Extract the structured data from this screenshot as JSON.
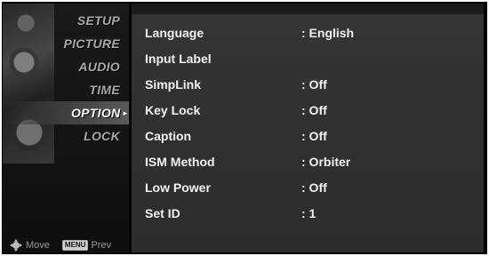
{
  "sidebar": {
    "items": [
      {
        "label": "SETUP",
        "active": false
      },
      {
        "label": "PICTURE",
        "active": false
      },
      {
        "label": "AUDIO",
        "active": false
      },
      {
        "label": "TIME",
        "active": false
      },
      {
        "label": "OPTION",
        "active": true
      },
      {
        "label": "LOCK",
        "active": false
      }
    ],
    "active_arrow": "▸",
    "footer": {
      "move_label": "Move",
      "menu_button": "MENU",
      "prev_label": "Prev"
    }
  },
  "main": {
    "rows": [
      {
        "label": "Language",
        "value": ": English"
      },
      {
        "label": "Input Label",
        "value": ""
      },
      {
        "label": "SimpLink",
        "value": ": Off"
      },
      {
        "label": "Key Lock",
        "value": ": Off"
      },
      {
        "label": "Caption",
        "value": ": Off"
      },
      {
        "label": "ISM Method",
        "value": ": Orbiter"
      },
      {
        "label": "Low Power",
        "value": ": Off"
      },
      {
        "label": "Set ID",
        "value": ": 1"
      }
    ]
  },
  "colors": {
    "background": "#050505",
    "panel": "#333333",
    "text": "#f2f2f2",
    "sidebar_text": "#a9a9a9"
  },
  "icons": [
    "move-icon"
  ]
}
